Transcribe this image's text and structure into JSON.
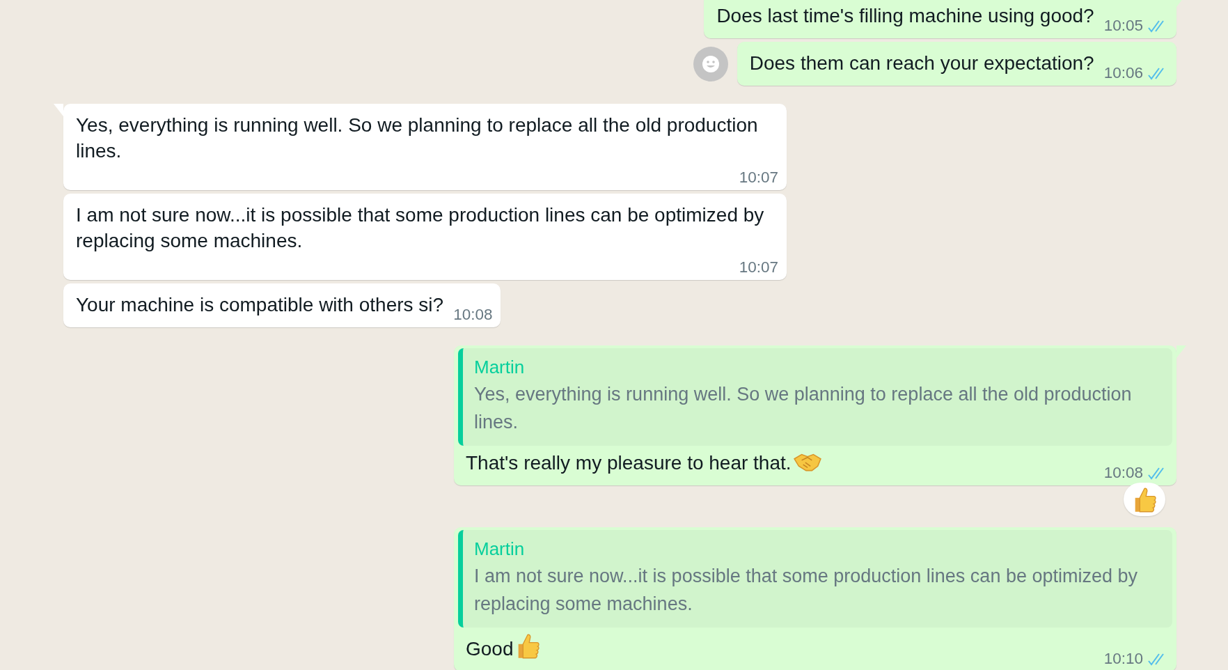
{
  "messages": [
    {
      "kind": "outgoing",
      "text": "Does last time's filling machine using good?",
      "time": "10:05",
      "read": true
    },
    {
      "kind": "outgoing",
      "text": "Does them can reach your expectation?",
      "time": "10:06",
      "read": true,
      "react_button": true
    },
    {
      "kind": "incoming",
      "text": "Yes, everything is running well. So we planning to replace all the old production lines.",
      "time": "10:07"
    },
    {
      "kind": "incoming",
      "text": "I am not sure now...it is possible that some production lines can be optimized by replacing some machines.",
      "time": "10:07"
    },
    {
      "kind": "incoming",
      "text": "Your machine is compatible with others si?",
      "time": "10:08"
    },
    {
      "kind": "outgoing",
      "quote": {
        "author": "Martin",
        "text": "Yes, everything is running well. So we planning to replace all the old production lines."
      },
      "text": "That's really my pleasure to hear that.",
      "emoji": {
        "kind": "handshake"
      },
      "time": "10:08",
      "read": true,
      "reaction": {
        "kind": "thumbs-up"
      }
    },
    {
      "kind": "outgoing",
      "quote": {
        "author": "Martin",
        "text": "I am not sure now...it is possible that some production lines can be optimized by replacing some machines."
      },
      "text": "Good",
      "emoji": {
        "kind": "thumbs-up"
      },
      "time": "10:10",
      "read": true
    }
  ]
}
